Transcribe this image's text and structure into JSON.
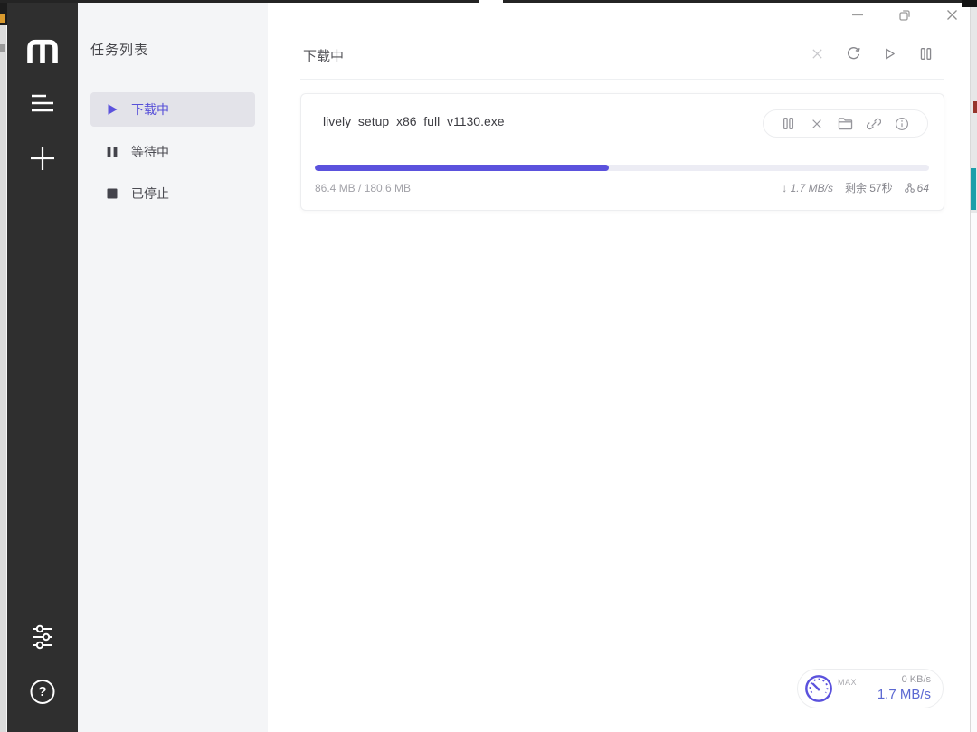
{
  "colors": {
    "accent": "#5b52dd",
    "accent-text": "#5750d8",
    "download-speed": "#5b68d2",
    "rail-bg": "#2f2f2f",
    "panel-bg": "#f4f5f7",
    "selected-bg": "#e3e3e9"
  },
  "rail": {
    "icons": [
      "motrix-logo",
      "task-list",
      "add-task",
      "preferences",
      "help"
    ],
    "help_glyph": "?"
  },
  "task_panel": {
    "title": "任务列表",
    "items": [
      {
        "label": "下载中",
        "icon": "play",
        "active": true
      },
      {
        "label": "等待中",
        "icon": "pause",
        "active": false
      },
      {
        "label": "已停止",
        "icon": "stop",
        "active": false
      }
    ]
  },
  "header": {
    "title": "下载中",
    "actions": [
      "delete-task",
      "refresh",
      "resume-all",
      "pause-all"
    ]
  },
  "window_controls": [
    "minimize",
    "maximize",
    "close"
  ],
  "task": {
    "filename": "lively_setup_x86_full_v1130.exe",
    "progress_percent": 47.8,
    "size_text": "86.4 MB / 180.6 MB",
    "speed_text": "↓ 1.7 MB/s",
    "remaining_text": "剩余 57秒",
    "connections": "64",
    "actions": [
      "pause",
      "delete",
      "open-folder",
      "copy-link",
      "info"
    ]
  },
  "speed_widget": {
    "mode_label": "MAX",
    "upload_speed": "0 KB/s",
    "download_speed": "1.7 MB/s"
  }
}
